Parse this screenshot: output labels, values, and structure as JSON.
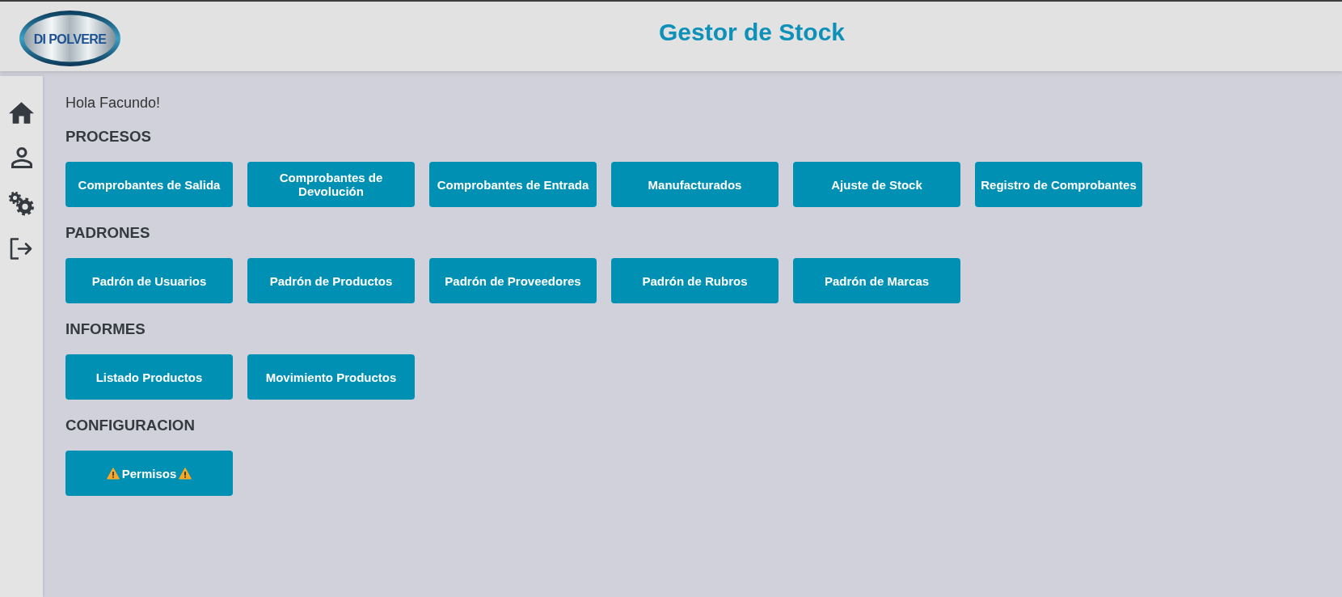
{
  "header": {
    "logo_text": "DI POLVERE",
    "title": "Gestor de Stock"
  },
  "greeting": "Hola Facundo!",
  "sections": [
    {
      "title": "PROCESOS",
      "buttons": [
        {
          "label": "Comprobantes de Salida",
          "kind": "plain"
        },
        {
          "label": "Comprobantes de Devolución",
          "kind": "plain"
        },
        {
          "label": "Comprobantes de Entrada",
          "kind": "plain"
        },
        {
          "label": "Manufacturados",
          "kind": "plain"
        },
        {
          "label": "Ajuste de Stock",
          "kind": "plain"
        },
        {
          "label": "Registro de Comprobantes",
          "kind": "plain"
        }
      ]
    },
    {
      "title": "PADRONES",
      "buttons": [
        {
          "label": "Padrón de Usuarios",
          "kind": "plain"
        },
        {
          "label": "Padrón de Productos",
          "kind": "plain"
        },
        {
          "label": "Padrón de Proveedores",
          "kind": "plain"
        },
        {
          "label": "Padrón de Rubros",
          "kind": "plain"
        },
        {
          "label": "Padrón de Marcas",
          "kind": "plain"
        }
      ]
    },
    {
      "title": "INFORMES",
      "buttons": [
        {
          "label": "Listado Productos",
          "kind": "plain"
        },
        {
          "label": "Movimiento Productos",
          "kind": "plain"
        }
      ]
    },
    {
      "title": "CONFIGURACION",
      "buttons": [
        {
          "label": "Permisos",
          "kind": "warning"
        }
      ]
    }
  ]
}
